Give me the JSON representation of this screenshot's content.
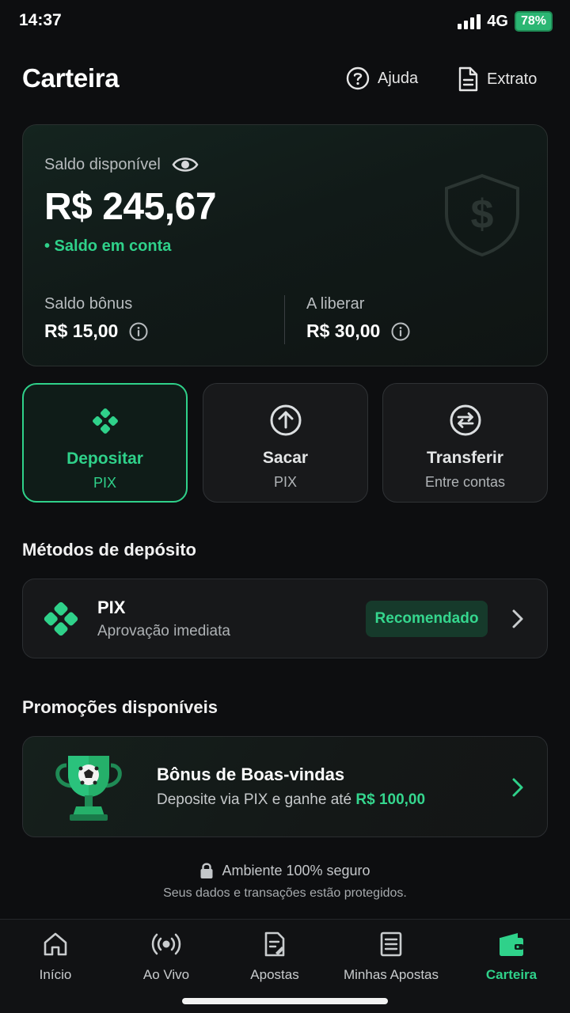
{
  "status_bar": {
    "time": "14:37",
    "network": "4G",
    "battery": "78%"
  },
  "header": {
    "title": "Carteira",
    "help_label": "Ajuda",
    "statement_label": "Extrato"
  },
  "balance": {
    "label": "Saldo disponível",
    "value": "R$ 245,67",
    "sub": "• Saldo em conta",
    "bonus_label": "Saldo bônus",
    "bonus_value": "R$ 15,00",
    "pending_label": "A liberar",
    "pending_value": "R$ 30,00"
  },
  "actions": [
    {
      "title": "Depositar",
      "sub": "PIX",
      "icon": "pix-icon",
      "active": true
    },
    {
      "title": "Sacar",
      "sub": "PIX",
      "icon": "arrow-up-circle-icon",
      "active": false
    },
    {
      "title": "Transferir",
      "sub": "Entre contas",
      "icon": "transfer-icon",
      "active": false
    }
  ],
  "methods": {
    "section_title": "Métodos de depósito",
    "items": [
      {
        "name": "PIX",
        "desc": "Aprovação imediata",
        "badge": "Recomendado"
      }
    ]
  },
  "promos": {
    "section_title": "Promoções disponíveis",
    "items": [
      {
        "title": "Bônus de Boas-vindas",
        "desc": "Deposite via PIX e ganhe até",
        "highlight": "R$ 100,00"
      }
    ]
  },
  "security": {
    "title": "Ambiente 100% seguro",
    "sub": "Seus dados e transações estão protegidos."
  },
  "nav": {
    "items": [
      {
        "label": "Início",
        "icon": "home-icon"
      },
      {
        "label": "Ao Vivo",
        "icon": "live-broadcast-icon"
      },
      {
        "label": "Apostas",
        "icon": "bet-slip-icon"
      },
      {
        "label": "Minhas Apostas",
        "icon": "document-list-icon"
      },
      {
        "label": "Carteira",
        "icon": "wallet-icon",
        "active": true
      }
    ]
  },
  "colors": {
    "accent": "#2fd18a",
    "background": "#0d0e10",
    "card": "#17181a"
  }
}
